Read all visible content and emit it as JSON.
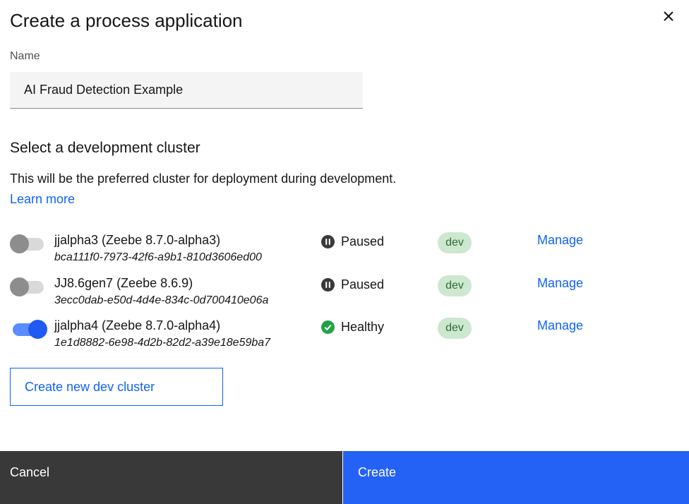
{
  "dialog": {
    "title": "Create a process application",
    "close_icon": "close-icon"
  },
  "name_field": {
    "label": "Name",
    "value": "AI Fraud Detection Example",
    "placeholder": ""
  },
  "cluster_section": {
    "heading": "Select a development cluster",
    "description": "This will be the preferred cluster for deployment during development.",
    "learn_more": "Learn more"
  },
  "clusters": [
    {
      "name": "jjalpha3 (Zeebe 8.7.0-alpha3)",
      "id": "bca111f0-7973-42f6-a9b1-810d3606ed00",
      "selected": false,
      "status": "Paused",
      "status_icon": "paused-icon",
      "tag": "dev",
      "manage": "Manage"
    },
    {
      "name": "JJ8.6gen7 (Zeebe 8.6.9)",
      "id": "3ecc0dab-e50d-4d4e-834c-0d700410e06a",
      "selected": false,
      "status": "Paused",
      "status_icon": "paused-icon",
      "tag": "dev",
      "manage": "Manage"
    },
    {
      "name": "jjalpha4 (Zeebe 8.7.0-alpha4)",
      "id": "1e1d8882-6e98-4d2b-82d2-a39e18e59ba7",
      "selected": true,
      "status": "Healthy",
      "status_icon": "healthy-check-icon",
      "tag": "dev",
      "manage": "Manage"
    }
  ],
  "new_cluster_button": "Create new dev cluster",
  "footer": {
    "cancel": "Cancel",
    "create": "Create"
  },
  "colors": {
    "primary": "#0f62fe",
    "create_button": "#2462f5",
    "cancel_button": "#393939",
    "tag_bg": "#cde8cf",
    "tag_text": "#2b6e32",
    "healthy": "#24a148",
    "paused": "#393939"
  }
}
